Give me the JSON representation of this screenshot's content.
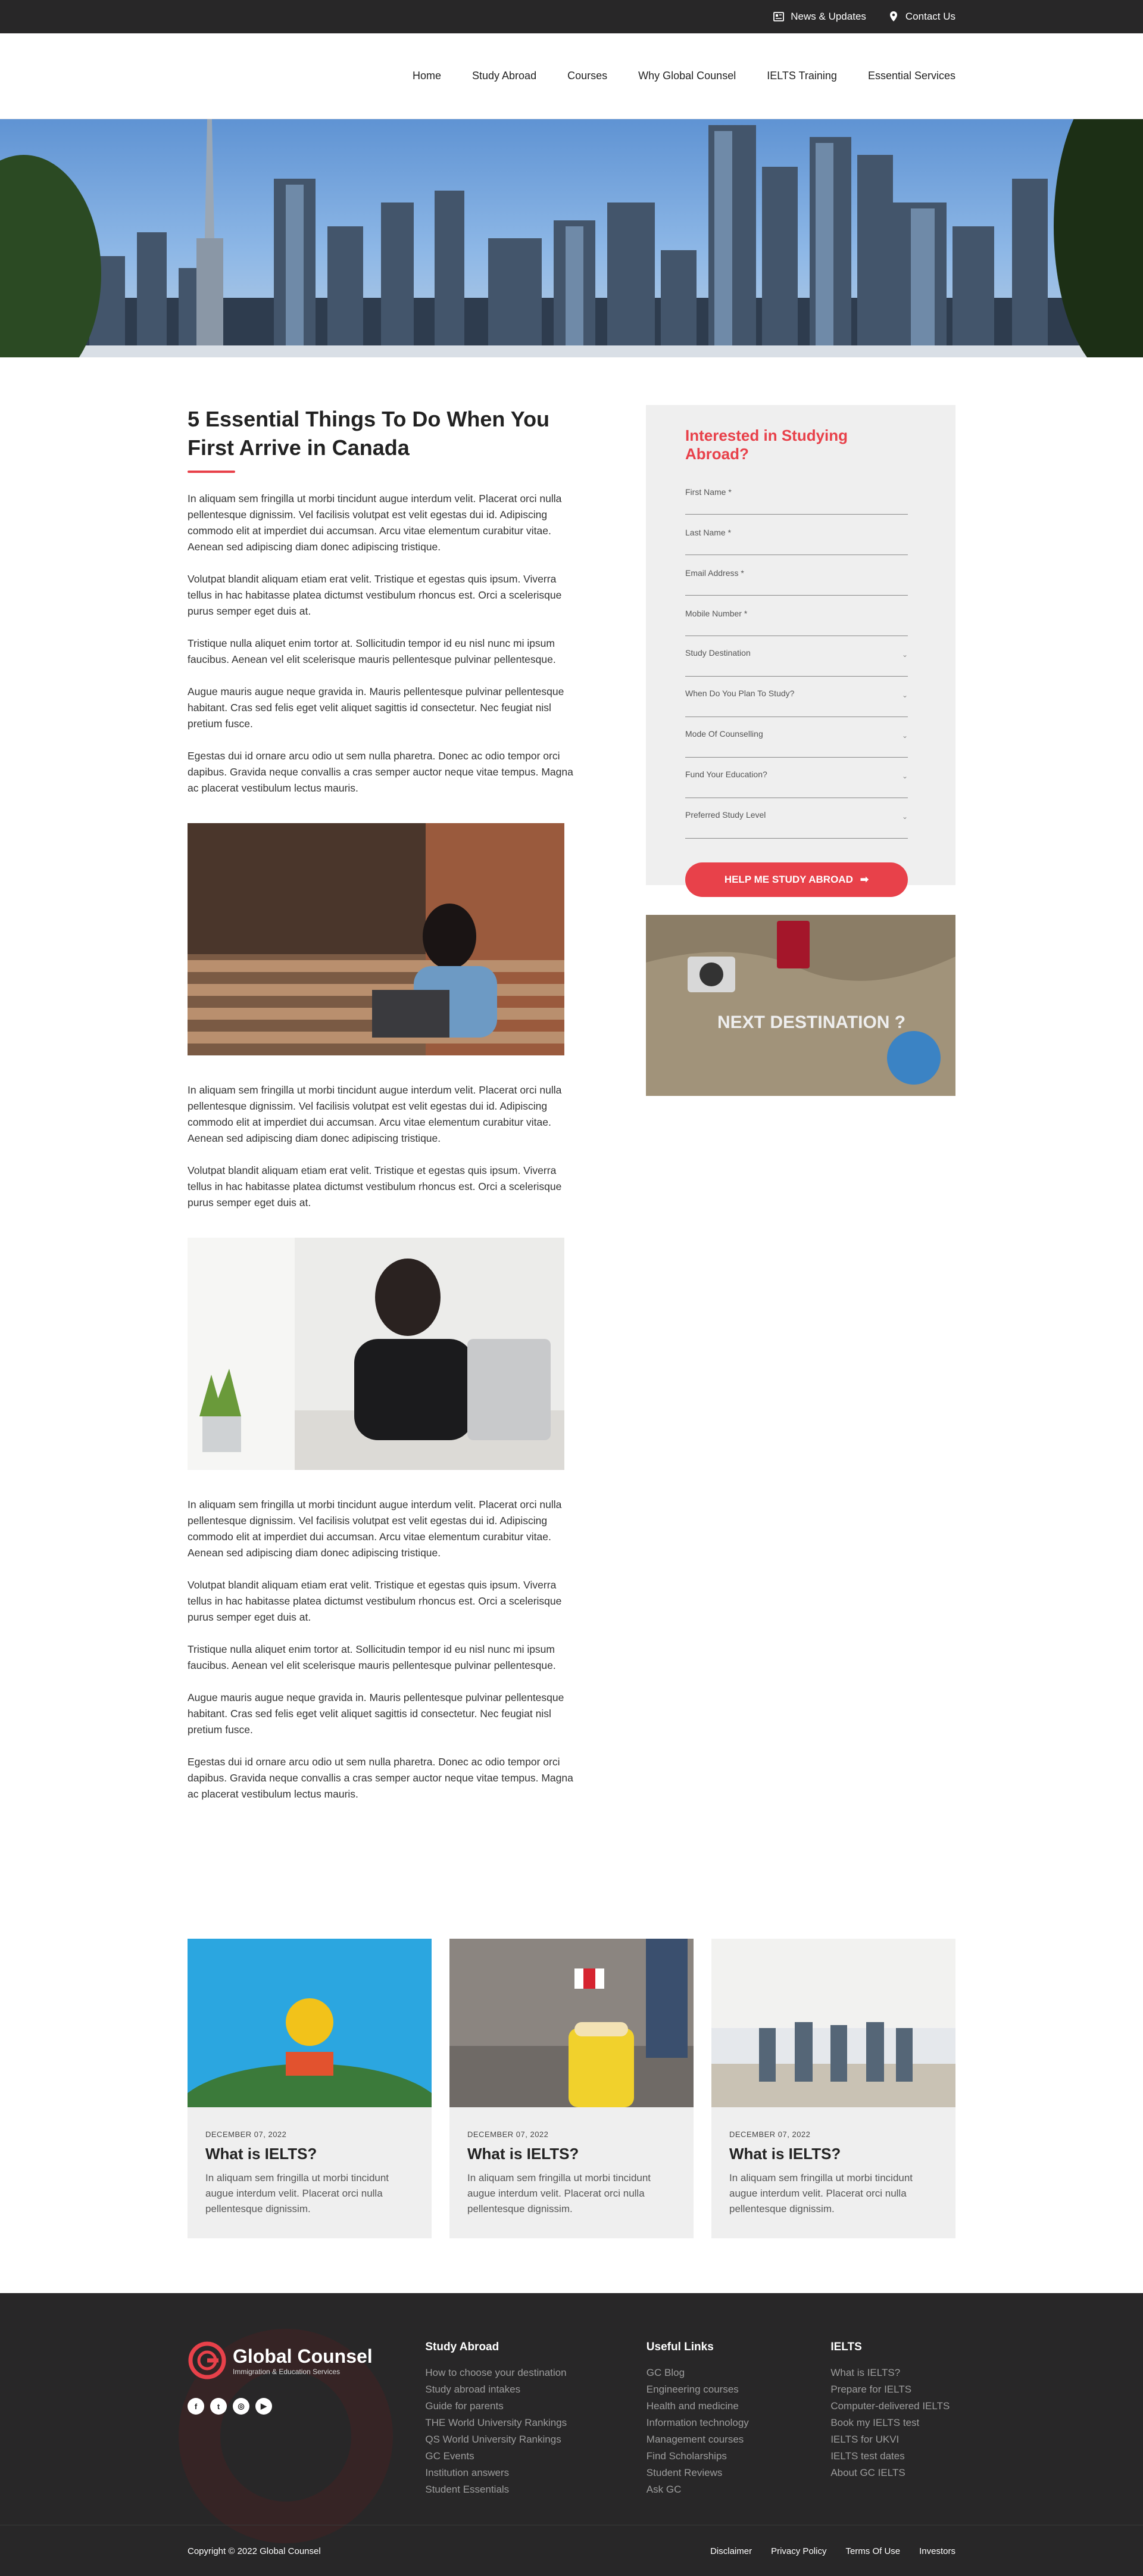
{
  "topbar": {
    "news_label": "News & Updates",
    "contact_label": "Contact Us"
  },
  "nav": {
    "items": [
      "Home",
      "Study Abroad",
      "Courses",
      "Why Global Counsel",
      "IELTS Training",
      "Essential Services"
    ]
  },
  "article": {
    "title": "5 Essential Things To Do When You First Arrive in Canada",
    "section1": [
      "In aliquam sem fringilla ut morbi tincidunt augue interdum velit. Placerat orci nulla pellentesque dignissim. Vel facilisis volutpat est velit egestas dui id. Adipiscing commodo elit at imperdiet dui accumsan. Arcu vitae elementum curabitur vitae. Aenean sed adipiscing diam donec adipiscing tristique.",
      "Volutpat blandit aliquam etiam erat velit. Tristique et egestas quis ipsum. Viverra tellus in hac habitasse platea dictumst vestibulum rhoncus est. Orci a scelerisque purus semper eget duis at.",
      "Tristique nulla aliquet enim tortor at. Sollicitudin tempor id eu nisl  nunc mi ipsum faucibus. Aenean vel elit scelerisque mauris pellentesque pulvinar pellentesque.",
      "Augue mauris augue neque gravida in. Mauris pellentesque pulvinar pellentesque habitant. Cras sed felis eget velit aliquet sagittis id consectetur. Nec feugiat nisl pretium fusce.",
      "Egestas dui id ornare arcu odio ut sem nulla pharetra. Donec ac odio tempor orci dapibus. Gravida neque convallis a cras semper auctor neque vitae tempus. Magna ac placerat vestibulum lectus mauris."
    ],
    "section2": [
      "In aliquam sem fringilla ut morbi tincidunt augue interdum velit. Placerat orci nulla pellentesque dignissim. Vel facilisis volutpat est velit egestas dui id. Adipiscing commodo elit at imperdiet dui accumsan. Arcu vitae elementum curabitur vitae. Aenean sed adipiscing diam donec adipiscing tristique.",
      "Volutpat blandit aliquam etiam erat velit. Tristique et egestas quis ipsum. Viverra tellus in hac habitasse platea dictumst vestibulum rhoncus est. Orci a scelerisque purus semper eget duis at."
    ],
    "section3": [
      "In aliquam sem fringilla ut morbi tincidunt augue interdum velit. Placerat orci nulla pellentesque dignissim. Vel facilisis volutpat est velit egestas dui id. Adipiscing commodo elit at imperdiet dui accumsan. Arcu vitae elementum curabitur vitae. Aenean sed adipiscing diam donec adipiscing tristique.",
      "Volutpat blandit aliquam etiam erat velit. Tristique et egestas quis ipsum. Viverra tellus in hac habitasse platea dictumst vestibulum rhoncus est. Orci a scelerisque purus semper eget duis at.",
      "Tristique nulla aliquet enim tortor at. Sollicitudin tempor id eu nisl nunc mi ipsum faucibus. Aenean vel elit scelerisque mauris pellentesque pulvinar pellentesque.",
      "Augue mauris augue neque gravida in. Mauris pellentesque pulvinar pellentesque habitant. Cras sed felis eget velit aliquet sagittis id consectetur. Nec feugiat nisl pretium fusce.",
      "Egestas dui id ornare arcu odio ut sem nulla pharetra. Donec ac odio tempor orci dapibus. Gravida neque convallis a cras semper auctor neque vitae tempus. Magna ac placerat vestibulum lectus mauris."
    ]
  },
  "form": {
    "heading": "Interested in Studying Abroad?",
    "fields": {
      "first_name": "First Name *",
      "last_name": "Last Name *",
      "email": "Email Address *",
      "mobile": "Mobile Number *",
      "destination": "Study Destination",
      "when": "When Do You Plan To Study?",
      "mode": "Mode Of Counselling",
      "fund": "Fund Your Education?",
      "level": "Preferred Study Level"
    },
    "submit_label": "HELP ME STUDY ABROAD",
    "side_image_text": "NEXT DESTINATION ?"
  },
  "cards": [
    {
      "date": "DECEMBER 07, 2022",
      "title": "What is IELTS?",
      "excerpt": "In aliquam sem fringilla ut morbi tincidunt augue interdum velit. Placerat orci nulla pellentesque dignissim."
    },
    {
      "date": "DECEMBER 07, 2022",
      "title": "What is IELTS?",
      "excerpt": "In aliquam sem fringilla ut morbi tincidunt augue interdum velit. Placerat orci nulla pellentesque dignissim."
    },
    {
      "date": "DECEMBER 07, 2022",
      "title": "What is IELTS?",
      "excerpt": "In aliquam sem fringilla ut morbi tincidunt augue interdum velit. Placerat orci nulla pellentesque dignissim."
    }
  ],
  "footer": {
    "brand_name": "Global Counsel",
    "brand_sub": "Immigration & Education Services",
    "study_abroad": {
      "heading": "Study Abroad",
      "links": [
        "How to choose your destination",
        "Study abroad intakes",
        "Guide for parents",
        "THE World University Rankings",
        "QS World University Rankings",
        "GC Events",
        "Institution answers",
        "Student Essentials"
      ]
    },
    "useful_links": {
      "heading": "Useful Links",
      "links": [
        "GC Blog",
        "Engineering courses",
        "Health and medicine",
        "Information technology",
        "Management courses",
        "Find Scholarships",
        "Student Reviews",
        "Ask GC"
      ]
    },
    "ielts": {
      "heading": "IELTS",
      "links": [
        "What is IELTS?",
        "Prepare for IELTS",
        "Computer-delivered IELTS",
        "Book my IELTS test",
        "IELTS for UKVI",
        "IELTS test dates",
        "About GC IELTS"
      ]
    },
    "copyright": "Copyright © 2022 Global Counsel",
    "legal": [
      "Disclaimer",
      "Privacy Policy",
      "Terms Of Use",
      "Investors"
    ]
  }
}
